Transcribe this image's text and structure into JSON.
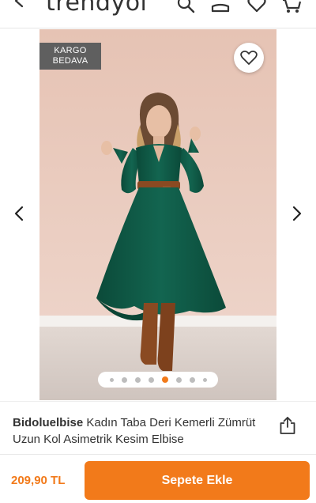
{
  "header": {
    "logo_text": "trendyol",
    "icons": [
      "back-arrow-icon",
      "search-icon",
      "account-icon",
      "favorites-icon",
      "cart-icon"
    ]
  },
  "gallery": {
    "badge_line1": "KARGO",
    "badge_line2": "BEDAVA",
    "image_count": 8,
    "active_index": 4,
    "colors": {
      "accent": "#f27a1a",
      "backdrop": "#e9c8b9",
      "dress": "#0f5a46",
      "belt": "#8a4a22"
    }
  },
  "product": {
    "brand": "Bidoluelbise",
    "name": "Kadın Taba Deri Kemerli Zümrüt Uzun Kol Asimetrik Kesim Elbise"
  },
  "bottom_bar": {
    "price": "209,90 TL",
    "add_to_cart_label": "Sepete Ekle"
  }
}
